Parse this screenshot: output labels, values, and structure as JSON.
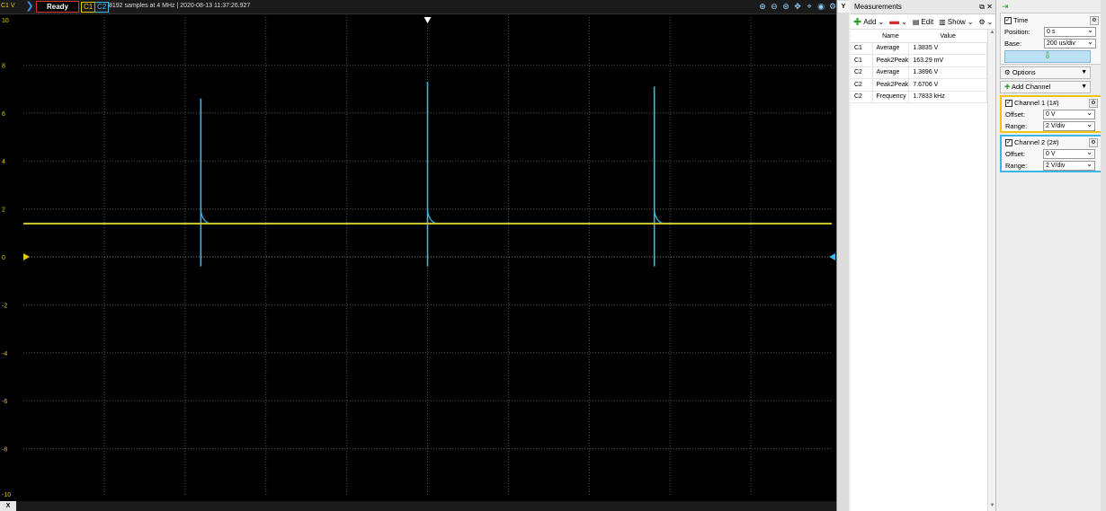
{
  "scope": {
    "axis_label": "C1 V",
    "status": "Ready",
    "chip_c1": "C1",
    "chip_c2": "C2",
    "info": "8192 samples at 4 MHz | 2020-08-13 11:37:26.927",
    "x_button": "X",
    "y_button": "Y",
    "colors": {
      "c1": "#e5c900",
      "c2": "#38b7e8",
      "grid": "#555555",
      "bg": "#000000"
    }
  },
  "chart_data": {
    "type": "line",
    "xlabel": "",
    "ylabel": "",
    "xlim": [
      -1,
      1
    ],
    "ylim": [
      -10,
      10
    ],
    "y_ticks": [
      "10",
      "8",
      "6",
      "4",
      "2",
      "0",
      "-2",
      "-4",
      "-6",
      "-8",
      "-10"
    ],
    "x_ticks": [
      "-1 ms",
      "-0.8 ms",
      "-0.6 ms",
      "-0.4 ms",
      "-0.2 ms",
      "0 ms",
      "0.2 ms",
      "0.4 ms",
      "0.6 ms",
      "0.8 ms",
      "1 ms"
    ],
    "series": [
      {
        "name": "C1",
        "color": "#e5c900",
        "x": [
          -1,
          1
        ],
        "y": [
          1.3835,
          1.3835
        ]
      },
      {
        "name": "C2",
        "color": "#38b7e8",
        "spikes": [
          {
            "x": -0.561,
            "top": 6.6,
            "bottom": -0.4
          },
          {
            "x": 0.0,
            "top": 7.3,
            "bottom": -0.4
          },
          {
            "x": 0.561,
            "top": 7.1,
            "bottom": -0.4
          }
        ],
        "baseline": 1.3896
      }
    ]
  },
  "measurements": {
    "title": "Measurements",
    "toolbar": {
      "add": "Add",
      "remove": "",
      "edit": "Edit",
      "show": "Show"
    },
    "columns": [
      "",
      "Name",
      "Value"
    ],
    "rows": [
      {
        "ch": "C1",
        "name": "Average",
        "value": "1.3835 V"
      },
      {
        "ch": "C1",
        "name": "Peak2Peak",
        "value": "163.29 mV"
      },
      {
        "ch": "C2",
        "name": "Average",
        "value": "1.3896 V"
      },
      {
        "ch": "C2",
        "name": "Peak2Peak",
        "value": "7.6706 V"
      },
      {
        "ch": "C2",
        "name": "Frequency",
        "value": "1.7833 kHz"
      }
    ]
  },
  "settings": {
    "time_label": "Time",
    "position_label": "Position:",
    "position_value": "0 s",
    "base_label": "Base:",
    "base_value": "200 us/div",
    "options_label": "Options",
    "add_channel_label": "Add Channel",
    "channel1": {
      "label": "Channel 1 (1#)",
      "offset_label": "Offset:",
      "offset_value": "0 V",
      "range_label": "Range:",
      "range_value": "2 V/div"
    },
    "channel2": {
      "label": "Channel 2 (2#)",
      "offset_label": "Offset:",
      "offset_value": "0 V",
      "range_label": "Range:",
      "range_value": "2 V/div"
    }
  }
}
